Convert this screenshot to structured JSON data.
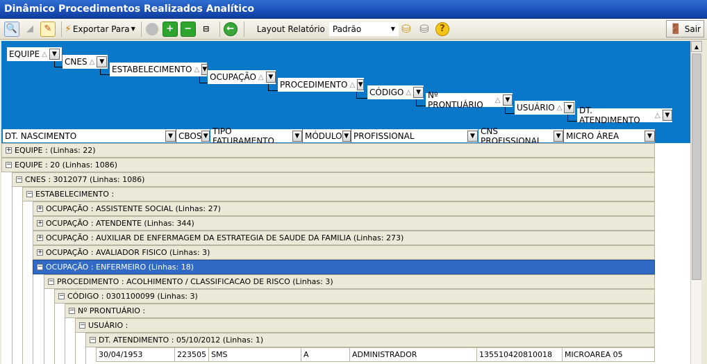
{
  "window": {
    "title": "Dinâmico Procedimentos Realizados Analítico"
  },
  "toolbar": {
    "export_label": "Exportar Para",
    "layout_label": "Layout Relatório",
    "layout_value": "Padrão",
    "exit_label": "Sair"
  },
  "pivot_fields": [
    "EQUIPE",
    "CNES",
    "ESTABELECIMENTO",
    "OCUPAÇÃO",
    "PROCEDIMENTO",
    "CÓDIGO",
    "Nº PRONTUÁRIO",
    "USUÁRIO",
    "DT. ATENDIMENTO"
  ],
  "columns": [
    "DT. NASCIMENTO",
    "CBOS",
    "TIPO FATURAMENTO",
    "MÓDULO",
    "PROFISSIONAL",
    "CNS PROFISSIONAL",
    "MICRO ÁREA"
  ],
  "rows": [
    {
      "text": "EQUIPE : (Linhas: 22)",
      "expander": "+"
    },
    {
      "text": "EQUIPE : 20 (Linhas: 1086)",
      "expander": "−"
    },
    {
      "text": "CNES : 3012077 (Linhas: 1086)",
      "expander": "−"
    },
    {
      "text": "ESTABELECIMENTO :",
      "expander": "−"
    },
    {
      "text": "OCUPAÇÃO : ASSISTENTE SOCIAL (Linhas: 27)",
      "expander": "+"
    },
    {
      "text": "OCUPAÇÃO : ATENDENTE (Linhas: 344)",
      "expander": "+"
    },
    {
      "text": "OCUPAÇÃO : AUXILIAR DE ENFERMAGEM DA ESTRATEGIA DE SAUDE DA FAMILIA (Linhas: 273)",
      "expander": "+"
    },
    {
      "text": "OCUPAÇÃO : AVALIADOR FISICO (Linhas: 3)",
      "expander": "+"
    },
    {
      "text": "OCUPAÇÃO : ENFERMEIRO (Linhas: 18)",
      "expander": "−"
    },
    {
      "text": "PROCEDIMENTO : ACOLHIMENTO / CLASSIFICACAO DE RISCO (Linhas: 3)",
      "expander": "−"
    },
    {
      "text": "CÓDIGO : 0301100099 (Linhas: 3)",
      "expander": "−"
    },
    {
      "text": "Nº PRONTUÁRIO :",
      "expander": "−"
    },
    {
      "text": "USUÁRIO :",
      "expander": "−"
    },
    {
      "text": "DT. ATENDIMENTO : 05/10/2012 (Linhas: 1)",
      "expander": "−"
    }
  ],
  "data_row": [
    "30/04/1953",
    "223505",
    "SMS",
    "A",
    "ADMINISTRADOR",
    "135510420810018",
    "MICROAREA 05"
  ]
}
